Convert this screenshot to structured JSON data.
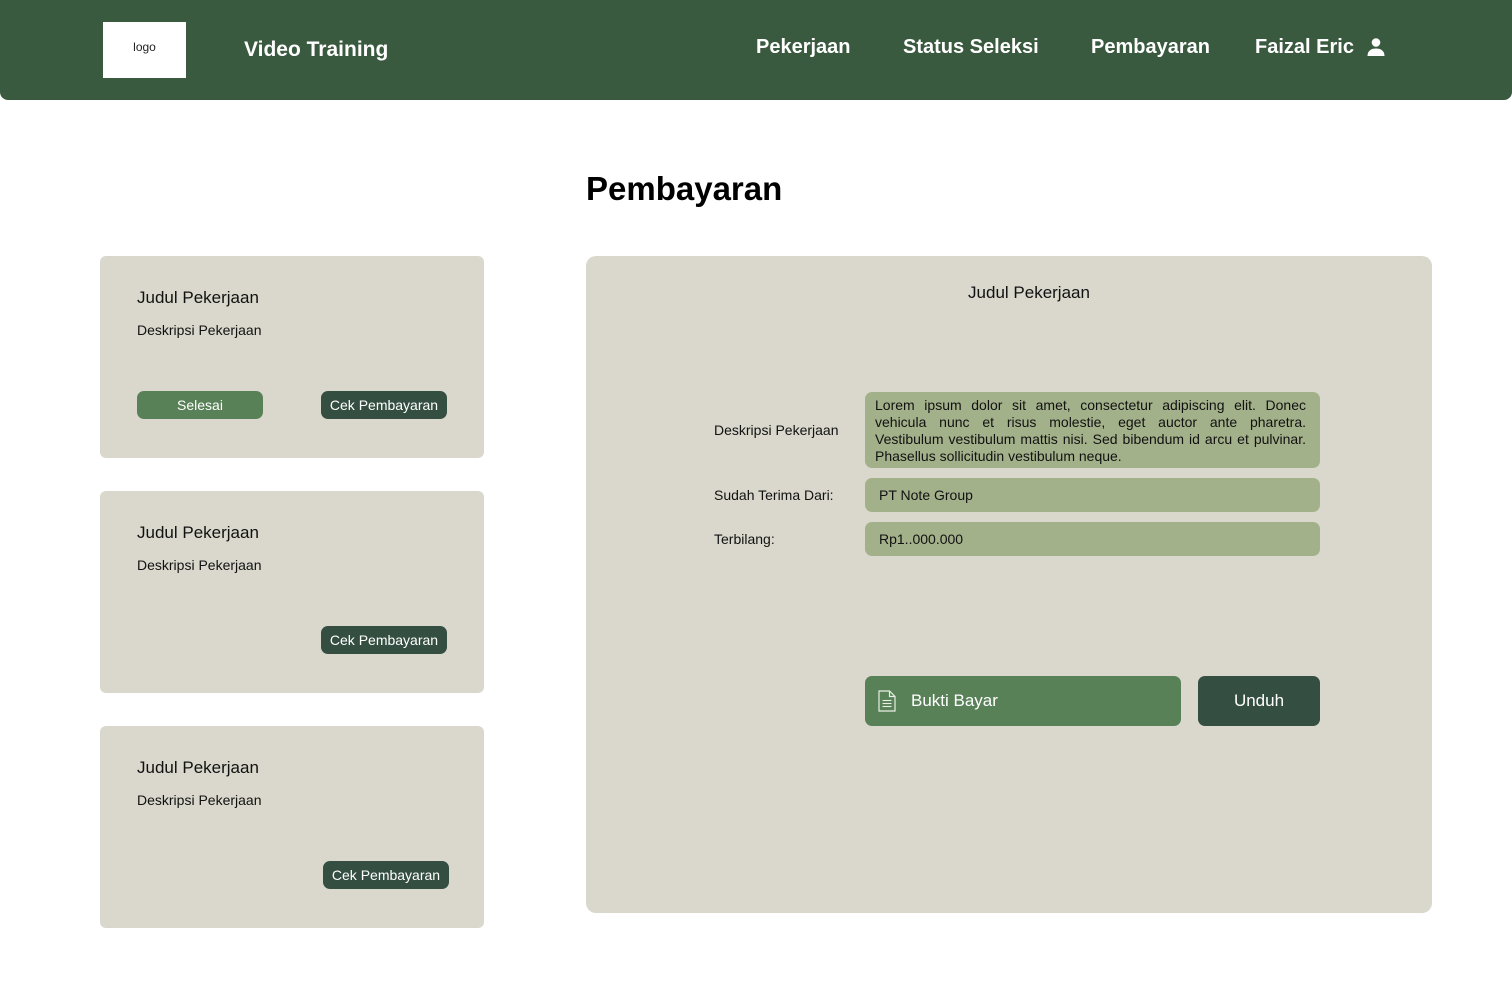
{
  "header": {
    "logo_text": "logo",
    "brand": "Video Training",
    "nav": [
      "Pekerjaan",
      "Status Seleksi",
      "Pembayaran"
    ],
    "user_name": "Faizal Eric",
    "user_icon": "user-icon"
  },
  "page": {
    "title": "Pembayaran"
  },
  "jobs": [
    {
      "title": "Judul Pekerjaan",
      "description": "Deskripsi Pekerjaan",
      "status": "Selesai",
      "action": "Cek Pembayaran"
    },
    {
      "title": "Judul Pekerjaan",
      "description": "Deskripsi Pekerjaan",
      "action": "Cek Pembayaran"
    },
    {
      "title": "Judul Pekerjaan",
      "description": "Deskripsi Pekerjaan",
      "action": "Cek Pembayaran"
    }
  ],
  "detail": {
    "title": "Judul Pekerjaan",
    "description_label": "Deskripsi Pekerjaan",
    "description_value": "Lorem ipsum dolor sit amet, consectetur adipiscing elit. Donec vehicula nunc et risus molestie, eget auctor ante pharetra. Vestibulum vestibulum mattis nisi. Sed bibendum id arcu et pulvinar. Phasellus sollicitudin vestibulum neque.",
    "received_from_label": "Sudah Terima Dari:",
    "received_from_value": "PT Note Group",
    "amount_label": "Terbilang:",
    "amount_value": "Rp1..000.000",
    "file_label": "Bukti Bayar",
    "file_icon": "document-icon",
    "download_label": "Unduh"
  },
  "colors": {
    "header_bg": "#3a5a40",
    "card_bg": "#dad8cc",
    "field_bg": "#a3b18a",
    "accent_green": "#588157",
    "dark_green": "#344e41"
  }
}
